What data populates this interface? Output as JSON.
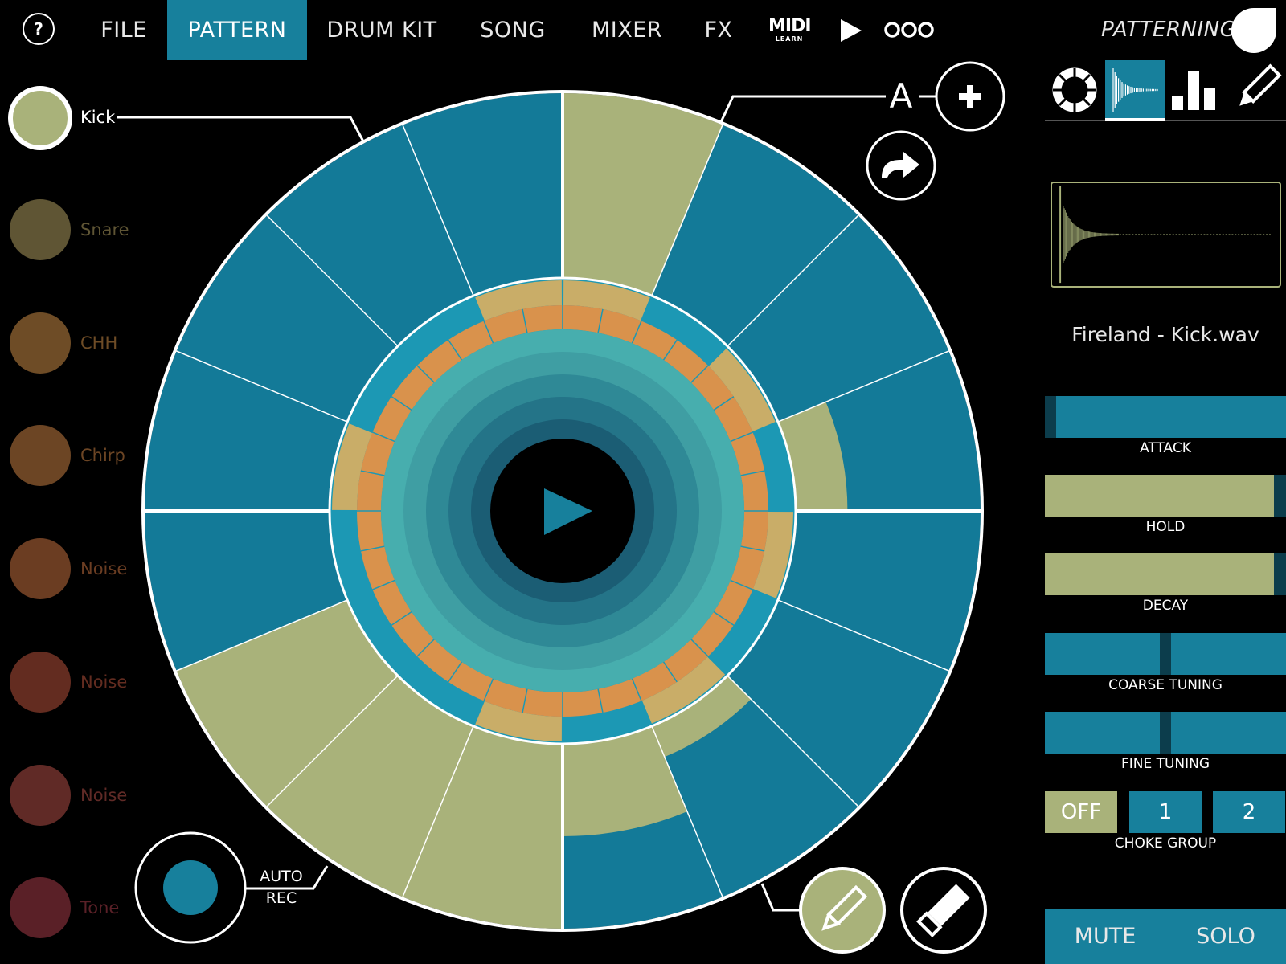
{
  "topbar": {
    "help_label": "?",
    "menu": [
      {
        "label": "FILE",
        "active": false
      },
      {
        "label": "PATTERN",
        "active": true
      },
      {
        "label": "DRUM KIT",
        "active": false
      },
      {
        "label": "SONG",
        "active": false
      },
      {
        "label": "MIXER",
        "active": false
      },
      {
        "label": "FX",
        "active": false
      }
    ],
    "midi_label": "MIDI",
    "midi_sub": "LEARN",
    "transport_play_icon": "play-icon",
    "more_icon": "ellipsis-icon",
    "brand": "PATTERNING",
    "brand_icon": "teardrop-logo-icon"
  },
  "instruments": [
    {
      "name": "Kick",
      "color": "#a9b27a",
      "selected": true
    },
    {
      "name": "Snare",
      "color": "#5f5534",
      "selected": false
    },
    {
      "name": "CHH",
      "color": "#6e4c26",
      "selected": false
    },
    {
      "name": "Chirp",
      "color": "#6c4524",
      "selected": false
    },
    {
      "name": "Noise",
      "color": "#6b3d22",
      "selected": false
    },
    {
      "name": "Noise",
      "color": "#632c20",
      "selected": false
    },
    {
      "name": "Noise",
      "color": "#602a26",
      "selected": false
    },
    {
      "name": "Tone",
      "color": "#5a2027",
      "selected": false
    }
  ],
  "pattern": {
    "label": "A",
    "add_icon": "plus-icon",
    "redo_icon": "redo-arrow-icon",
    "center_play_icon": "play-icon",
    "steps": 16,
    "active_steps": [
      0,
      8,
      9,
      10
    ],
    "partial_steps": [
      {
        "step": 3,
        "velocity": 0.28
      },
      {
        "step": 6,
        "velocity": 0.18
      },
      {
        "step": 7,
        "velocity": 0.5
      }
    ],
    "colors": {
      "step_off": "#137a98",
      "step_on": "#a9b27a",
      "mid_ring": "#1c98b4",
      "orange": "#d9924c",
      "gold": "#c9ad68"
    }
  },
  "auto_rec": {
    "line1": "AUTO",
    "line2": "REC"
  },
  "tools": {
    "draw_icon": "pencil-icon",
    "erase_icon": "eraser-icon"
  },
  "panel": {
    "tabs": [
      {
        "icon": "ring-icon",
        "active": false
      },
      {
        "icon": "waveform-icon",
        "active": true
      },
      {
        "icon": "bar-graph-icon",
        "active": false
      },
      {
        "icon": "pencil-icon",
        "active": false
      }
    ],
    "sample_name": "Fireland - Kick.wav",
    "sliders": [
      {
        "label": "ATTACK",
        "value": 0.02
      },
      {
        "label": "HOLD",
        "value": 0.97
      },
      {
        "label": "DECAY",
        "value": 0.97
      },
      {
        "label": "COARSE TUNING",
        "value": 0.5
      },
      {
        "label": "FINE TUNING",
        "value": 0.5
      }
    ],
    "choke": {
      "label": "CHOKE GROUP",
      "options": [
        {
          "label": "OFF",
          "active": true
        },
        {
          "label": "1",
          "active": false
        },
        {
          "label": "2",
          "active": false
        }
      ]
    },
    "mute_label": "MUTE",
    "solo_label": "SOLO"
  }
}
